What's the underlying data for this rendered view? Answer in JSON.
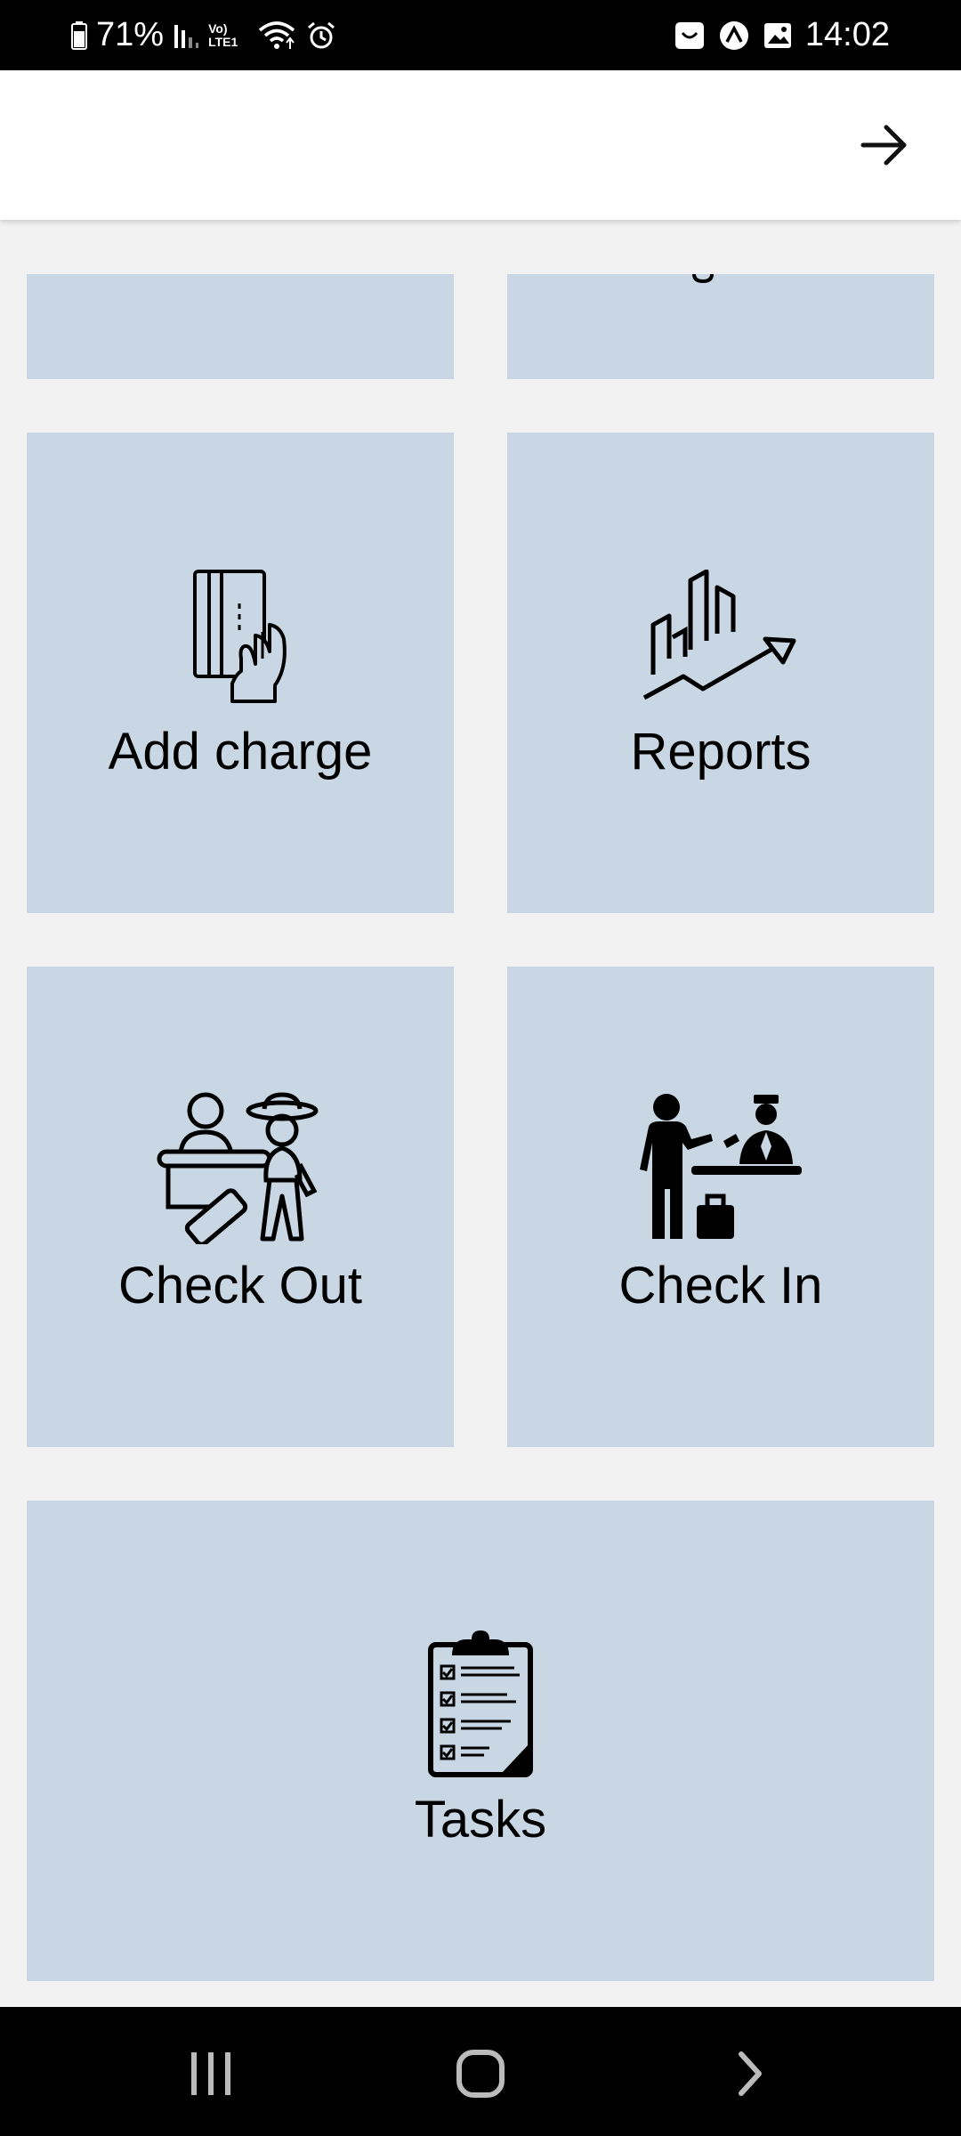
{
  "status_bar": {
    "battery_percent": "71%",
    "network_label": "Vo) LTE1",
    "time": "14:02",
    "icons": [
      "battery-icon",
      "signal-icon",
      "volte-icon",
      "wifi-icon",
      "alarm-icon",
      "bag-icon",
      "nav-app-icon",
      "image-icon"
    ]
  },
  "app_bar": {
    "forward_icon": "arrow-right-icon"
  },
  "tiles": {
    "top_left_partial": {
      "label": ""
    },
    "top_right_partial": {
      "label": ""
    },
    "add_charge": {
      "label": "Add charge",
      "icon": "card-payment-icon"
    },
    "reports": {
      "label": "Reports",
      "icon": "growth-chart-icon"
    },
    "check_out": {
      "label": "Check Out",
      "icon": "check-out-icon"
    },
    "check_in": {
      "label": "Check In",
      "icon": "check-in-icon"
    },
    "tasks": {
      "label": "Tasks",
      "icon": "clipboard-checklist-icon"
    }
  },
  "colors": {
    "tile_bg": "#c9d6e3",
    "page_bg": "#f2f2f2",
    "app_bar_bg": "#ffffff",
    "system_bar_bg": "#000000"
  },
  "nav_bar": {
    "buttons": [
      "recent-apps-icon",
      "home-icon",
      "back-icon"
    ]
  }
}
